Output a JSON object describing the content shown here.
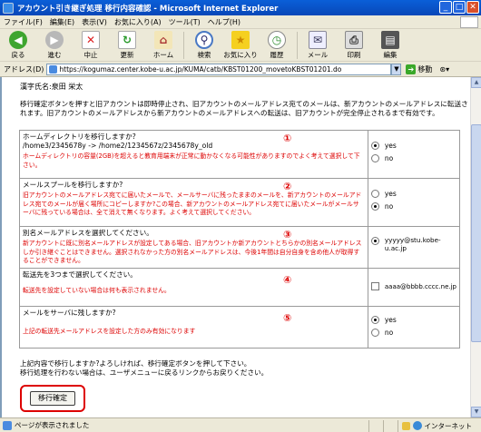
{
  "window": {
    "title": "アカウント引き継ぎ処理 移行内容確認 - Microsoft Internet Explorer",
    "min": "_",
    "max": "□",
    "close": "✕"
  },
  "menu": [
    "ファイル(F)",
    "編集(E)",
    "表示(V)",
    "お気に入り(A)",
    "ツール(T)",
    "ヘルプ(H)"
  ],
  "toolbar": {
    "back": "戻る",
    "forward": "進む",
    "stop": "中止",
    "refresh": "更新",
    "home": "ホーム",
    "search": "検索",
    "favorites": "お気に入り",
    "history": "履歴",
    "mail": "メール",
    "print": "印刷",
    "edit": "編集"
  },
  "address": {
    "label": "アドレス(D)",
    "url": "https://kogumaz.center.kobe-u.ac.jp/KUMA/catb/KBST01200_movetoKBST01201.do",
    "go": "移動"
  },
  "page": {
    "user_line": "漢字氏名:泉田 栄太",
    "intro": "移行確定ボタンを押すと旧アカウントは即時停止され、旧アカウントのメールアドレス宛てのメールは、新アカウントのメールアドレスに転送されます。旧アカウントのメールアドレスから新アカウントのメールアドレスへの転送は、旧アカウントが完全停止されるまで有効です。",
    "options": [
      {
        "num": "①",
        "question": "ホームディレクトリを移行しますか?",
        "detail": "/home3/2345678y -> /home2/1234567z/2345678y_old",
        "note": "ホームディレクトリの容量(2GB)を超えると教育用端末が正常に動かなくなる可能性がありますのでよく考えて選択して下さい。",
        "answers": [
          {
            "label": "yes",
            "selected": true
          },
          {
            "label": "no",
            "selected": false
          }
        ]
      },
      {
        "num": "②",
        "question": "メールスプールを移行しますか?",
        "note": "旧アカウントのメールアドレス宛てに届いたメールで、メールサーバに残ったままのメールを、新アカウントのメールアドレス宛てのメールが届く場所にコピーしますか?この場合、新アカウントのメールアドレス宛てに届いたメールがメールサーバに残っている場合は、全て消えて無くなります。よく考えて選択してください。",
        "answers": [
          {
            "label": "yes",
            "selected": false
          },
          {
            "label": "no",
            "selected": true
          }
        ]
      },
      {
        "num": "③",
        "question": "別名メールアドレスを選択してください。",
        "note": "新アカウントに既に別名メールアドレスが設定してある場合、旧アカウントか新アカウントとちらかの別名メールアドレスしか引き継ぐことはできません。選択されなかった方の別名メールアドレスは、今後1年間は自分自身を含め他人が取得することができません。",
        "answers": [
          {
            "label": "yyyyy@stu.kobe-u.ac.jp",
            "selected": true
          }
        ]
      },
      {
        "num": "④",
        "question": "転送先を3つまで選択してください。",
        "note": "転送先を設定していない場合は何も表示されません。",
        "checkbox_label": "aaaa@bbbb.cccc.ne.jp"
      },
      {
        "num": "⑤",
        "question": "メールをサーバに残しますか?",
        "note": "上記の転送先メールアドレスを設定した方のみ有効になります",
        "answers": [
          {
            "label": "yes",
            "selected": true
          },
          {
            "label": "no",
            "selected": false
          }
        ]
      }
    ],
    "confirm_line1": "上記内容で移行しますか?よろしければ、移行確定ボタンを押して下さい。",
    "confirm_line2": "移行処理を行わない場合は、ユーザメニューに戻るリンクからお戻りください。",
    "confirm_button": "移行確定"
  },
  "status": {
    "text": "ページが表示されました",
    "zone": "インターネット"
  },
  "colors": {
    "accent_red": "#dd0000",
    "title_blue": "#0a5fd8"
  }
}
